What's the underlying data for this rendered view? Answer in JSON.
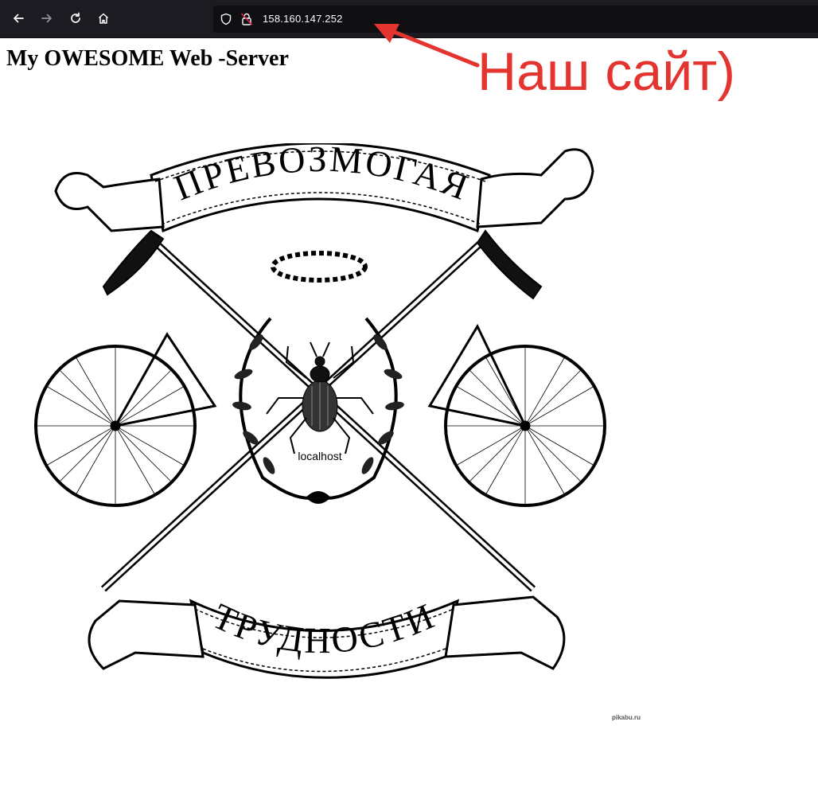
{
  "browser": {
    "url": "158.160.147.252"
  },
  "page": {
    "heading": "My OWESOME Web -Server"
  },
  "annotation": {
    "text": "Наш сайт)",
    "color": "#e3342f"
  },
  "emblem": {
    "banner_top": "ПРЕВОЗМОГАЯ",
    "banner_bottom": "ТРУДНОСТИ",
    "center_label": "localhost",
    "watermark": "pikabu.ru"
  }
}
